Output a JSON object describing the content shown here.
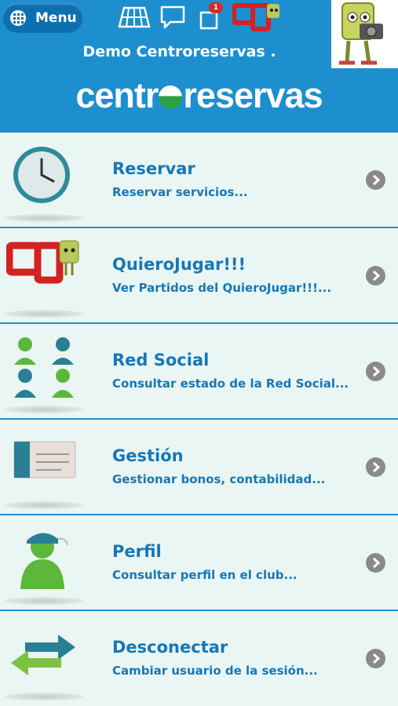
{
  "header": {
    "menu_label": "Menu",
    "notification_count": "1",
    "club_name": "Demo Centroreservas .",
    "brand_left": "centr",
    "brand_right": "reservas"
  },
  "menu_items": [
    {
      "title": "Reservar",
      "subtitle": "Reservar servicios...",
      "icon": "clock-icon"
    },
    {
      "title": "QuieroJugar!!!",
      "subtitle": "Ver Partidos del QuieroJugar!!!...",
      "icon": "quierojugar-logo-icon"
    },
    {
      "title": "Red Social",
      "subtitle": "Consultar estado de la Red Social...",
      "icon": "people-group-icon"
    },
    {
      "title": "Gestión",
      "subtitle": "Gestionar bonos, contabilidad...",
      "icon": "card-icon"
    },
    {
      "title": "Perfil",
      "subtitle": "Consultar perfil en el club...",
      "icon": "user-profile-icon"
    },
    {
      "title": "Desconectar",
      "subtitle": "Cambiar usuario de la sesión...",
      "icon": "swap-arrows-icon"
    }
  ],
  "colors": {
    "header_bg": "#1d8fce",
    "accent_text": "#1677b8",
    "list_bg": "#eaf6f3"
  }
}
